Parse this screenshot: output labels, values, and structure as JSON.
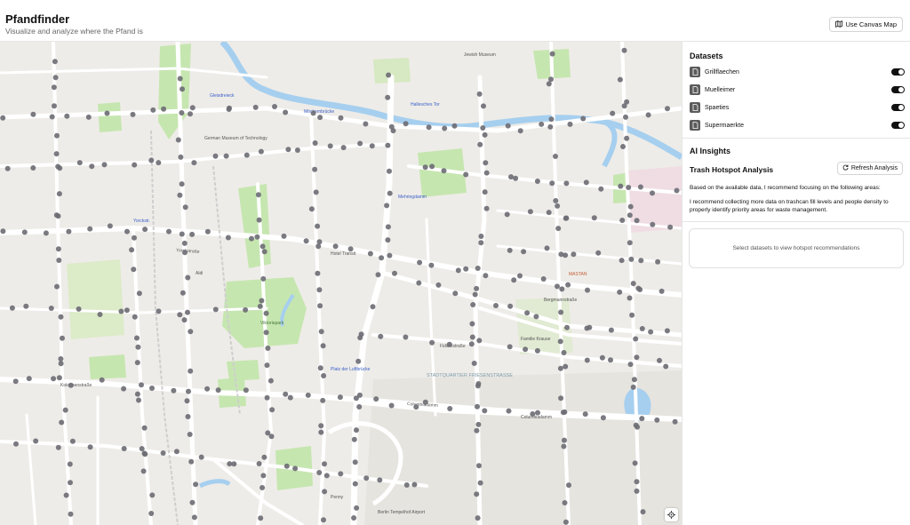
{
  "header": {
    "title": "Pfandfinder",
    "subtitle": "Visualize and analyze where the Pfand is",
    "canvas_button": "Use Canvas Map"
  },
  "sidebar": {
    "datasets_title": "Datasets",
    "datasets": [
      {
        "label": "Grillflaechen",
        "enabled": true
      },
      {
        "label": "Muelleimer",
        "enabled": true
      },
      {
        "label": "Spaeties",
        "enabled": true
      },
      {
        "label": "Supermaerkte",
        "enabled": true
      }
    ],
    "ai_title": "AI Insights",
    "analysis_title": "Trash Hotspot Analysis",
    "refresh_button": "Refresh Analysis",
    "intro_text": "Based on the available data, I recommend focusing on the following areas:",
    "recommendation_text": "I recommend collecting more data on trashcan fill levels and people density to properly identify priority areas for waste management.",
    "empty_state": "Select datasets to view hotspot recommendations"
  },
  "map": {
    "labels": {
      "yorckstrasse": "Yorckstraße",
      "kolonnenstrasse": "Kolonnenstraße",
      "columbiadamm": "Columbiadamm",
      "viktoriapark": "Viktoriapark",
      "mehringdamm": "Mehringdamm",
      "gleisdreieck": "Gleisdreieck",
      "platz_luftbruecke": "Platz der Luftbrücke",
      "stadtquartier": "STADTQUARTIER FRIESENSTRASSE",
      "tempelhof_airport": "Berlin Tempelhof Airport",
      "jewish_museum": "Jewish Museum",
      "technikmuseum": "German Museum of Technology",
      "hallesches_tor": "Hallesches Tor",
      "moeckernbruecke": "Möckernbrücke",
      "yorckstr_station": "Yorckstr.",
      "hotel_transit": "Hotel Transit",
      "mastan": "MASTAN",
      "familie_kraus": "Familie Krause",
      "bergmannstrasse": "Bergmannstraße",
      "fuldastrasse": "Fidicinstraße",
      "penny": "Penny",
      "aldi": "Aldi"
    },
    "colors": {
      "water": "#a6cfef",
      "park": "#c6e6b0",
      "road": "#ffffff",
      "marker": "#6b6b73",
      "land": "#eeece8"
    }
  }
}
